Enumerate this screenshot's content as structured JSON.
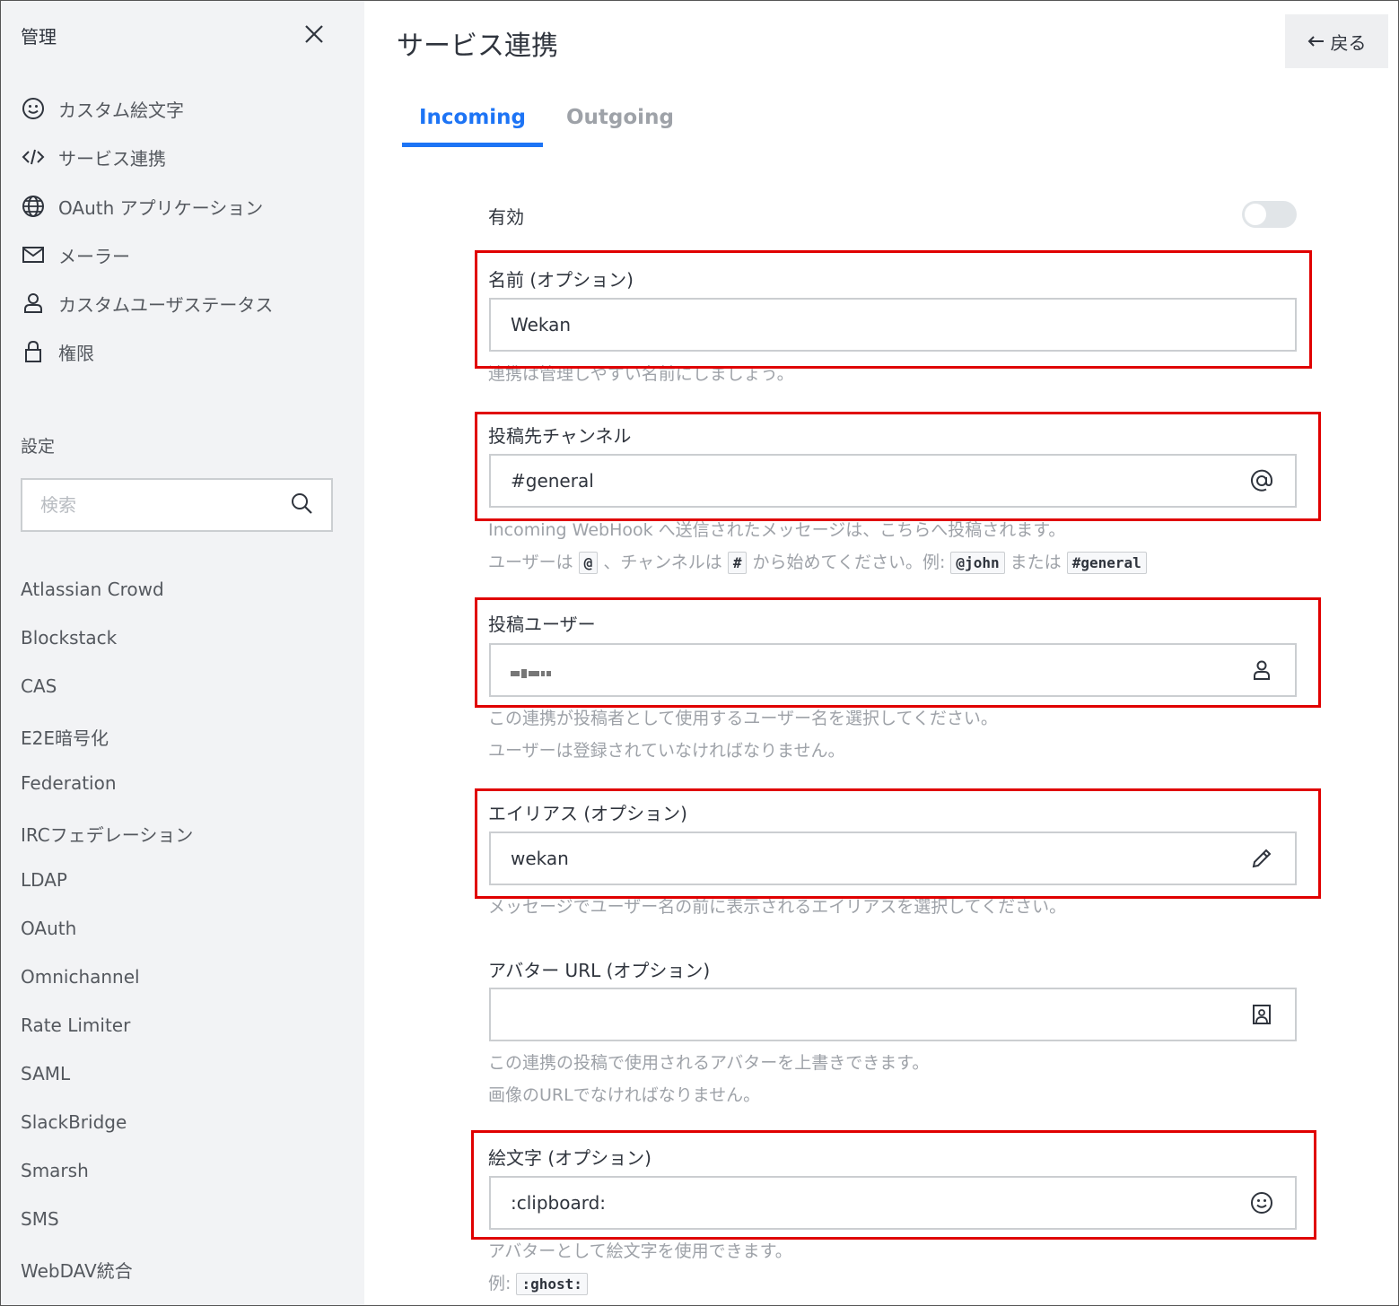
{
  "sidebar": {
    "title": "管理",
    "nav": [
      {
        "label": "カスタム絵文字",
        "icon": "smiley-icon"
      },
      {
        "label": "サービス連携",
        "icon": "code-icon"
      },
      {
        "label": "OAuth アプリケーション",
        "icon": "globe-icon"
      },
      {
        "label": "メーラー",
        "icon": "mail-icon"
      },
      {
        "label": "カスタムユーザステータス",
        "icon": "user-icon"
      },
      {
        "label": "権限",
        "icon": "lock-icon"
      }
    ],
    "settings_label": "設定",
    "search_placeholder": "検索",
    "settings": [
      "Atlassian Crowd",
      "Blockstack",
      "CAS",
      "E2E暗号化",
      "Federation",
      "IRCフェデレーション",
      "LDAP",
      "OAuth",
      "Omnichannel",
      "Rate Limiter",
      "SAML",
      "SlackBridge",
      "Smarsh",
      "SMS",
      "WebDAV統合"
    ]
  },
  "header": {
    "title": "サービス連携",
    "back_label": "戻る"
  },
  "tabs": {
    "incoming": "Incoming",
    "outgoing": "Outgoing"
  },
  "form": {
    "enabled_label": "有効",
    "enabled": false,
    "name": {
      "label": "名前 (オプション)",
      "value": "Wekan",
      "hint": "連携は管理しやすい名前にしましょう。"
    },
    "channel": {
      "label": "投稿先チャンネル",
      "value": "#general",
      "hint1": "Incoming WebHook へ送信されたメッセージは、こちらへ投稿されます。",
      "hint2_a": "ユーザーは",
      "hint2_code1": "@",
      "hint2_b": "、チャンネルは",
      "hint2_code2": "#",
      "hint2_c": "から始めてください。例:",
      "hint2_code3": "@john",
      "hint2_d": "または",
      "hint2_code4": "#general"
    },
    "user": {
      "label": "投稿ユーザー",
      "hint1": "この連携が投稿者として使用するユーザー名を選択してください。",
      "hint2": "ユーザーは登録されていなければなりません。"
    },
    "alias": {
      "label": "エイリアス (オプション)",
      "value": "wekan",
      "hint": "メッセージでユーザー名の前に表示されるエイリアスを選択してください。"
    },
    "avatar": {
      "label": "アバター URL (オプション)",
      "value": "",
      "hint1": "この連携の投稿で使用されるアバターを上書きできます。",
      "hint2": "画像のURLでなければなりません。"
    },
    "emoji": {
      "label": "絵文字 (オプション)",
      "value": ":clipboard:",
      "hint1": "アバターとして絵文字を使用できます。",
      "hint2_a": "例:",
      "hint2_code": ":ghost:"
    }
  },
  "colors": {
    "accent": "#1d74f5",
    "highlight": "#e00000"
  }
}
